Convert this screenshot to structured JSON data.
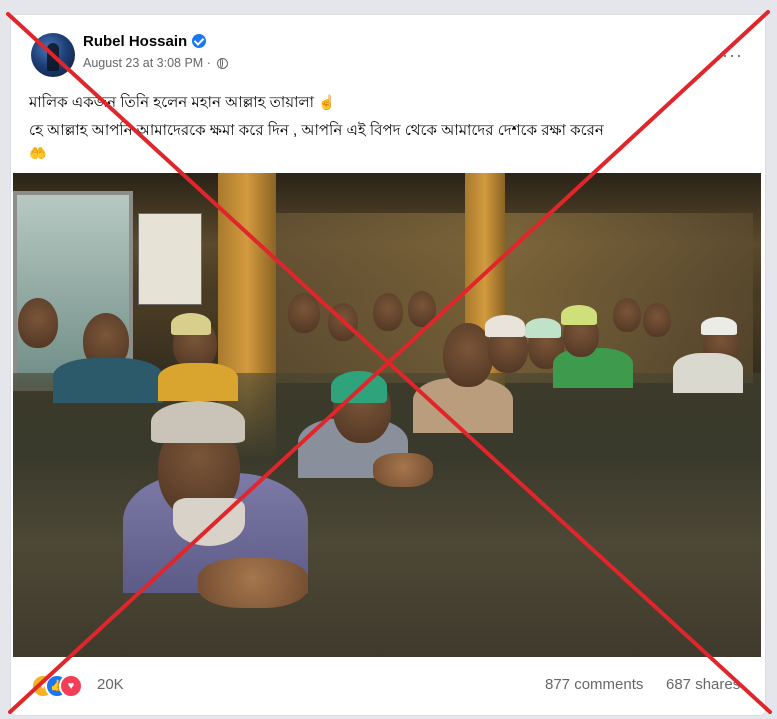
{
  "post": {
    "author": "Rubel Hossain",
    "verified_icon": "verified-badge-icon",
    "timestamp": "August 23 at 3:08 PM",
    "separator": "·",
    "privacy_icon": "globe-icon",
    "more_label": "···",
    "lines": [
      "মালিক একজন তিনি হলেন মহান আল্লাহ তায়ালা",
      "হে আল্লাহ আপনি আমাদেরকে ক্ষমা করে দিন , আপনি এই বিপদ থেকে আমাদের দেশকে রক্ষা করেন",
      ""
    ],
    "emoji": {
      "point_up": "☝",
      "praying_hands": "🤲"
    }
  },
  "reactions": {
    "icons": [
      "care-icon",
      "like-icon",
      "love-icon"
    ],
    "count": "20K",
    "comments": "877 comments",
    "shares": "687 shares"
  },
  "overlay": {
    "color": "#e0262b"
  }
}
